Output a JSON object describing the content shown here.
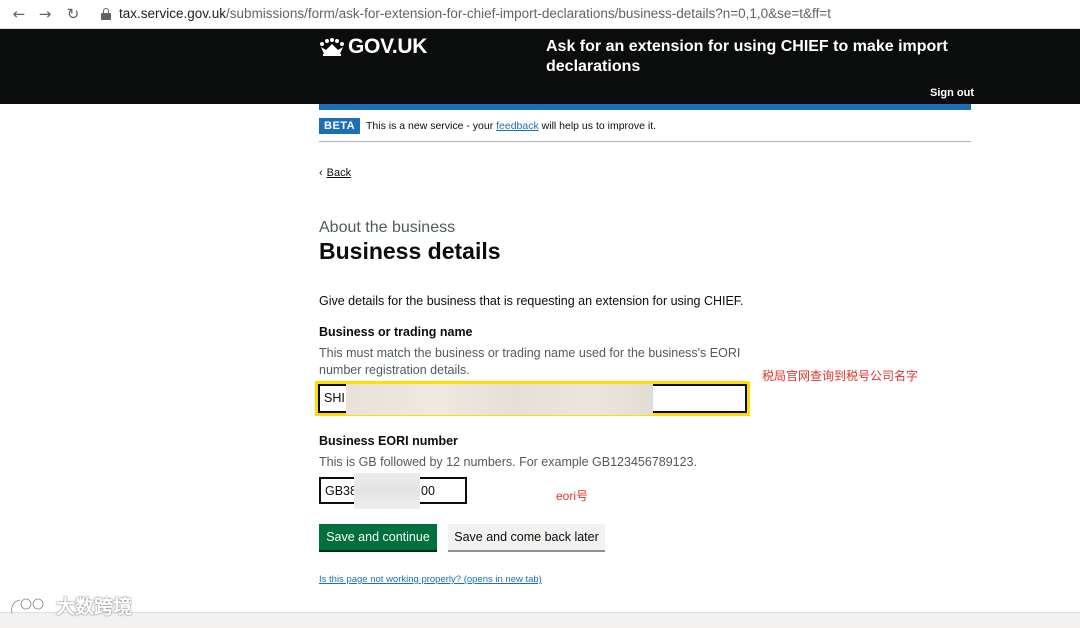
{
  "browser": {
    "back_glyph": "←",
    "forward_glyph": "→",
    "reload_glyph": "↻",
    "url_host": "tax.service.gov.uk",
    "url_path": "/submissions/form/ask-for-extension-for-chief-import-declarations/business-details?n=0,1,0&se=t&ff=t"
  },
  "header": {
    "logo": "GOV.UK",
    "service_name": "Ask for an extension for using CHIEF to make import declarations",
    "sign_out": "Sign out"
  },
  "phase_banner": {
    "tag": "BETA",
    "text_before": "This is a new service - your ",
    "link": "feedback",
    "text_after": " will help us to improve it."
  },
  "back_link": "Back",
  "back_chevron": "‹",
  "page": {
    "caption": "About the business",
    "heading": "Business details",
    "intro": "Give details for the business that is requesting an extension for using CHIEF."
  },
  "fields": {
    "business_name": {
      "label": "Business or trading name",
      "hint": "This must match the business or trading name used for the business's EORI number registration details.",
      "value_visible": "SHI"
    },
    "eori": {
      "label": "Business EORI number",
      "hint": "This is GB followed by 12 numbers. For example GB123456789123.",
      "value_start": "GB38",
      "value_end": "00"
    }
  },
  "annotations": {
    "name_note": "税局官网查询到税号公司名字",
    "eori_note": "eori号"
  },
  "buttons": {
    "save_continue": "Save and continue",
    "save_later": "Save and come back later"
  },
  "help_link": "Is this page not working properly? (opens in new tab)",
  "watermark": "大数跨境",
  "colors": {
    "header_bg": "#0b0c0c",
    "link_blue": "#1d70b8",
    "primary_button": "#00703c",
    "focus_yellow": "#ffdd00",
    "annotation_red": "#e0342c"
  }
}
